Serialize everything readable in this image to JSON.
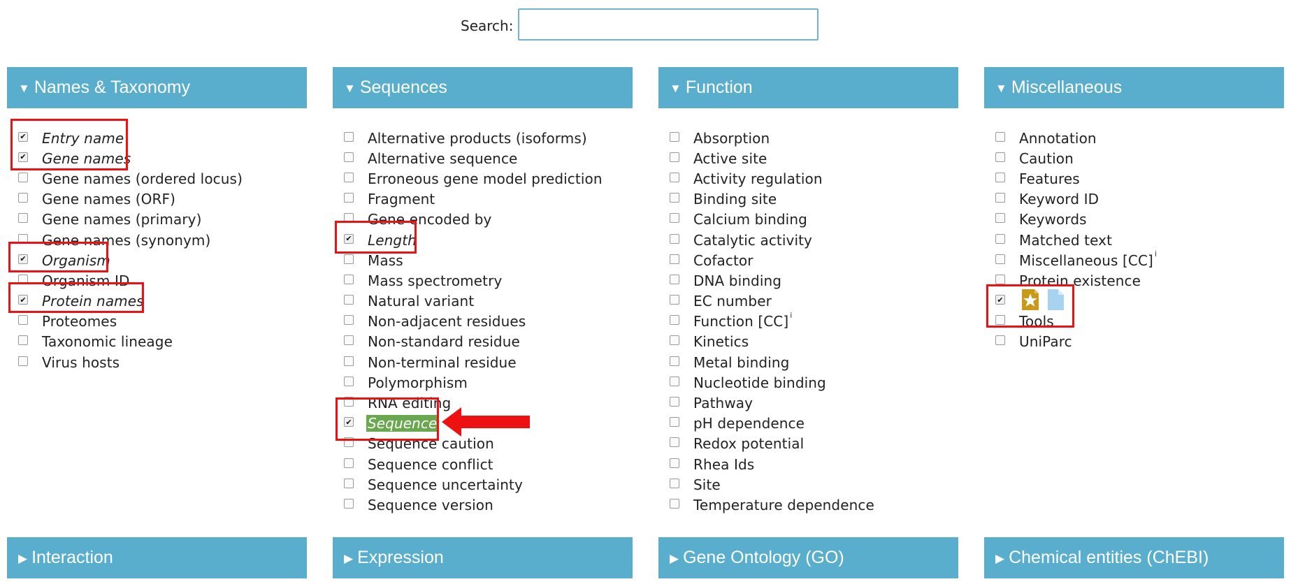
{
  "search": {
    "label": "Search:",
    "value": "",
    "placeholder": ""
  },
  "colors": {
    "header_bg": "#5aaecd",
    "annotation": "#ee1111",
    "highlight": "#6aa84f"
  },
  "sections": {
    "names_taxonomy": {
      "title": "Names & Taxonomy",
      "expanded": true,
      "items": [
        {
          "label": "Entry name",
          "checked": true
        },
        {
          "label": "Gene names",
          "checked": true
        },
        {
          "label": "Gene names (ordered locus)",
          "checked": false
        },
        {
          "label": "Gene names (ORF)",
          "checked": false
        },
        {
          "label": "Gene names (primary)",
          "checked": false
        },
        {
          "label": "Gene names (synonym)",
          "checked": false
        },
        {
          "label": "Organism",
          "checked": true
        },
        {
          "label": "Organism ID",
          "checked": false
        },
        {
          "label": "Protein names",
          "checked": true
        },
        {
          "label": "Proteomes",
          "checked": false
        },
        {
          "label": "Taxonomic lineage",
          "checked": false
        },
        {
          "label": "Virus hosts",
          "checked": false
        }
      ]
    },
    "sequences": {
      "title": "Sequences",
      "expanded": true,
      "items": [
        {
          "label": "Alternative products (isoforms)",
          "checked": false
        },
        {
          "label": "Alternative sequence",
          "checked": false
        },
        {
          "label": "Erroneous gene model prediction",
          "checked": false
        },
        {
          "label": "Fragment",
          "checked": false
        },
        {
          "label": "Gene encoded by",
          "checked": false
        },
        {
          "label": "Length",
          "checked": true
        },
        {
          "label": "Mass",
          "checked": false
        },
        {
          "label": "Mass spectrometry",
          "checked": false
        },
        {
          "label": "Natural variant",
          "checked": false
        },
        {
          "label": "Non-adjacent residues",
          "checked": false
        },
        {
          "label": "Non-standard residue",
          "checked": false
        },
        {
          "label": "Non-terminal residue",
          "checked": false
        },
        {
          "label": "Polymorphism",
          "checked": false
        },
        {
          "label": "RNA editing",
          "checked": false
        },
        {
          "label": "Sequence",
          "checked": true
        },
        {
          "label": "Sequence caution",
          "checked": false
        },
        {
          "label": "Sequence conflict",
          "checked": false
        },
        {
          "label": "Sequence uncertainty",
          "checked": false
        },
        {
          "label": "Sequence version",
          "checked": false
        }
      ]
    },
    "function": {
      "title": "Function",
      "expanded": true,
      "items": [
        {
          "label": "Absorption",
          "checked": false
        },
        {
          "label": "Active site",
          "checked": false
        },
        {
          "label": "Activity regulation",
          "checked": false
        },
        {
          "label": "Binding site",
          "checked": false
        },
        {
          "label": "Calcium binding",
          "checked": false
        },
        {
          "label": "Catalytic activity",
          "checked": false
        },
        {
          "label": "Cofactor",
          "checked": false
        },
        {
          "label": "DNA binding",
          "checked": false
        },
        {
          "label": "EC number",
          "checked": false
        },
        {
          "label": "Function [CC]",
          "sup": "i",
          "checked": false
        },
        {
          "label": "Kinetics",
          "checked": false
        },
        {
          "label": "Metal binding",
          "checked": false
        },
        {
          "label": "Nucleotide binding",
          "checked": false
        },
        {
          "label": "Pathway",
          "checked": false
        },
        {
          "label": "pH dependence",
          "checked": false
        },
        {
          "label": "Redox potential",
          "checked": false
        },
        {
          "label": "Rhea Ids",
          "checked": false
        },
        {
          "label": "Site",
          "checked": false
        },
        {
          "label": "Temperature dependence",
          "checked": false
        }
      ]
    },
    "misc": {
      "title": "Miscellaneous",
      "expanded": true,
      "items": [
        {
          "label": "Annotation",
          "checked": false
        },
        {
          "label": "Caution",
          "checked": false
        },
        {
          "label": "Features",
          "checked": false
        },
        {
          "label": "Keyword ID",
          "checked": false
        },
        {
          "label": "Keywords",
          "checked": false
        },
        {
          "label": "Matched text",
          "checked": false
        },
        {
          "label": "Miscellaneous [CC]",
          "sup": "i",
          "checked": false
        },
        {
          "label": "Protein existence",
          "checked": false
        },
        {
          "label": "",
          "icons": [
            "reviewed-star-icon",
            "document-icon"
          ],
          "checked": true
        },
        {
          "label": "Tools",
          "checked": false
        },
        {
          "label": "UniParc",
          "checked": false
        }
      ]
    },
    "interaction": {
      "title": "Interaction",
      "expanded": false
    },
    "expression": {
      "title": "Expression",
      "expanded": false
    },
    "gene_ontology": {
      "title": "Gene Ontology (GO)",
      "expanded": false
    },
    "chebi": {
      "title": "Chemical entities (ChEBI)",
      "expanded": false
    }
  }
}
